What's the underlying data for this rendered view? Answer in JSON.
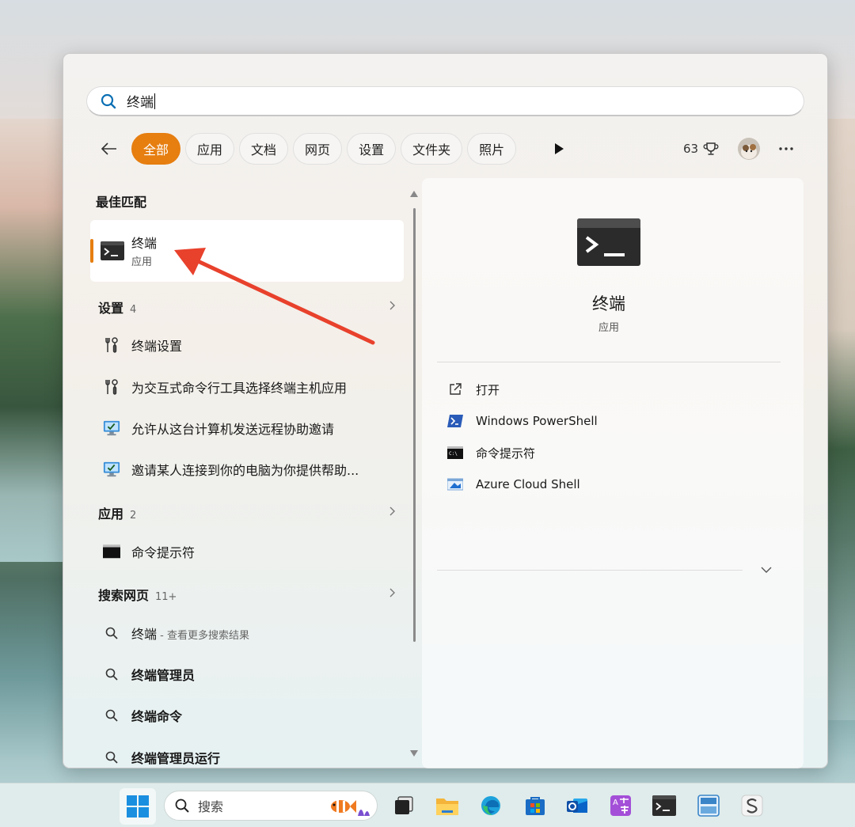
{
  "search": {
    "value": "终端"
  },
  "filters": {
    "chips": [
      {
        "label": "全部",
        "active": true
      },
      {
        "label": "应用"
      },
      {
        "label": "文档"
      },
      {
        "label": "网页"
      },
      {
        "label": "设置"
      },
      {
        "label": "文件夹"
      },
      {
        "label": "照片"
      }
    ],
    "points": "63"
  },
  "best_match": {
    "heading": "最佳匹配",
    "title": "终端",
    "subtitle": "应用"
  },
  "settings_group": {
    "heading": "设置",
    "count": "4",
    "items": [
      {
        "label": "终端设置",
        "icon": "settings-wrench-icon"
      },
      {
        "label": "为交互式命令行工具选择终端主机应用",
        "icon": "settings-wrench-icon"
      },
      {
        "label": "允许从这台计算机发送远程协助邀请",
        "icon": "remote-assistance-icon"
      },
      {
        "label": "邀请某人连接到你的电脑为你提供帮助...",
        "icon": "remote-assistance-icon"
      }
    ]
  },
  "apps_group": {
    "heading": "应用",
    "count": "2",
    "items": [
      {
        "label": "命令提示符",
        "icon": "command-prompt-icon"
      }
    ]
  },
  "web_group": {
    "heading": "搜索网页",
    "count": "11+",
    "items": [
      {
        "label": "终端",
        "hint": " - 查看更多搜索结果"
      },
      {
        "label": "终端管理员"
      },
      {
        "label": "终端命令"
      },
      {
        "label": "终端管理员运行"
      }
    ]
  },
  "detail": {
    "title": "终端",
    "subtitle": "应用",
    "actions": [
      {
        "label": "打开",
        "icon": "open-external-icon"
      },
      {
        "label": "Windows PowerShell",
        "icon": "powershell-icon"
      },
      {
        "label": "命令提示符",
        "icon": "command-prompt-icon"
      },
      {
        "label": "Azure Cloud Shell",
        "icon": "azure-cloud-shell-icon"
      }
    ]
  },
  "taskbar": {
    "search_label": "搜索",
    "apps": [
      "task-view-icon",
      "file-explorer-icon",
      "edge-icon",
      "store-icon",
      "outlook-icon",
      "language-app-icon",
      "terminal-icon",
      "lyric-editor-icon",
      "s-app-icon"
    ]
  },
  "colors": {
    "accent": "#e67e10",
    "annotation_arrow": "#e8412c"
  }
}
